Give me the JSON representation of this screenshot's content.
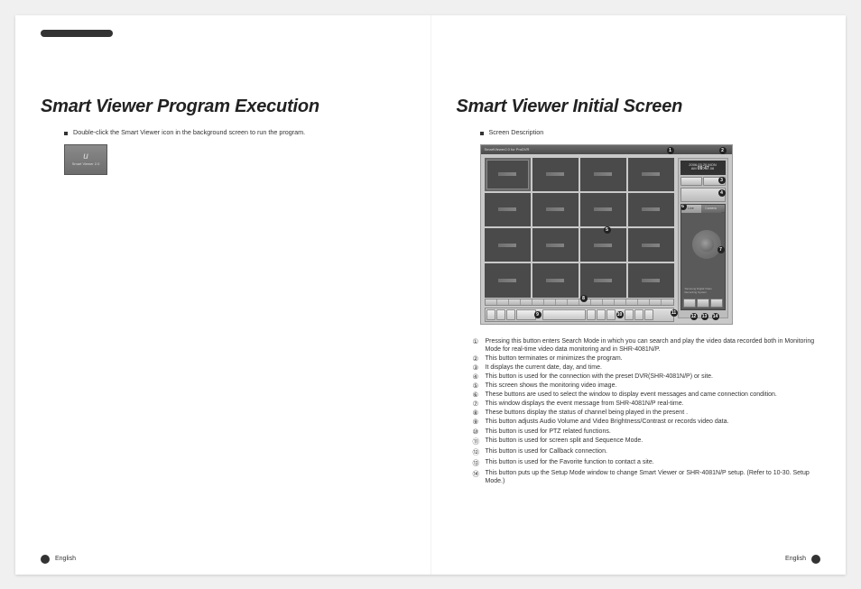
{
  "left_page": {
    "title": "Smart Viewer Program Execution",
    "bullet": "Double-click the Smart Viewer icon in the background screen to run the program.",
    "icon_label_top": "u",
    "icon_label_bottom": "Smart Viewer 2.0",
    "footer": "English"
  },
  "right_page": {
    "title": "Smart Viewer Initial Screen",
    "bullet": "Screen Description",
    "app_titlebar": "SmartViewer2.0 for ProDVR",
    "date_line": "2006.03.20.MON",
    "time_line_prefix": "AM ",
    "time_line_main": "09:47",
    "time_line_suffix": ".06",
    "tab_live": "Live",
    "tab_camera": "Camera",
    "panel_brand": "Samsung Digital Video Recording System",
    "footer": "English",
    "callout_numbers": {
      "n1": "1",
      "n2": "2",
      "n3": "3",
      "n4": "4",
      "n5": "5",
      "n6": "6",
      "n7": "7",
      "n8": "8",
      "n9": "9",
      "n10": "10",
      "n11": "11",
      "n12": "12",
      "n13": "13",
      "n14": "14"
    },
    "descriptions": [
      {
        "num": "①",
        "text": "Pressing this button enters Search Mode in which you can search and play the video data recorded both in Monitoring Mode for real-time video data monitoring and in SHR-4081N/P."
      },
      {
        "num": "②",
        "text": "This button terminates or minimizes the program."
      },
      {
        "num": "③",
        "text": "It displays the current date, day, and time."
      },
      {
        "num": "④",
        "text": "This button is used for the connection with the preset DVR(SHR-4081N/P) or site."
      },
      {
        "num": "⑤",
        "text": "This screen shows the monitoring video image."
      },
      {
        "num": "⑥",
        "text": "These buttons are used to select the window to display event messages and came connection condition."
      },
      {
        "num": "⑦",
        "text": "This window displays the event message from SHR-4081N/P real-time."
      },
      {
        "num": "⑧",
        "text": "These buttons display the status of channel being played in the present ."
      },
      {
        "num": "⑨",
        "text": "This button adjusts Audio Volume and Video Brightness/Contrast or records video data."
      },
      {
        "num": "⑩",
        "text": "This button is used for PTZ related functions."
      },
      {
        "num": "⑪",
        "text": "This button is used for screen split and Sequence Mode."
      },
      {
        "num": "⑫",
        "text": "This button is used for Callback connection."
      },
      {
        "num": "⑬",
        "text": "This button is used for the Favorite function to contact a site."
      },
      {
        "num": "⑭",
        "text": "This button puts up the Setup Mode window to change Smart Viewer or SHR-4081N/P setup. (Refer to 10-30. Setup Mode.)"
      }
    ]
  }
}
